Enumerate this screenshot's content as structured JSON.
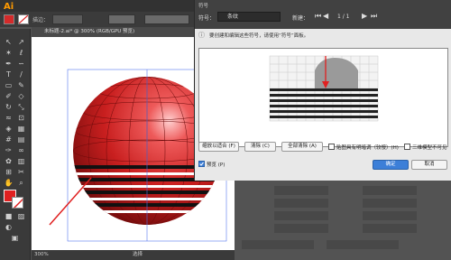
{
  "app": {
    "logo": "Ai"
  },
  "control_bar": {
    "stroke_label": "描边：",
    "fill_color": "#e02020"
  },
  "document": {
    "tab_title": "未标题-2.ai* @ 300% (RGB/GPU 预览)",
    "zoom": "300%",
    "status_label": "选择"
  },
  "dialog": {
    "title": "符号",
    "symbol_label": "符号：",
    "symbol_value": "条纹",
    "new_label": "新建：",
    "page_counter": "1 / 1",
    "message": "要创建和编辑这些符号，请使用“符号”面板。",
    "buttons": {
      "scale_to_fit": "缩放以适合 (F)",
      "clear": "清除 (C)",
      "clear_all": "全部清除 (A)",
      "ok": "确定",
      "cancel": "取消"
    },
    "checks": {
      "shade_artwork": "贴图具有明暗调（较慢）(H)",
      "invisible_geometry": "三维模型不可见",
      "preview": "预览 (P)"
    }
  },
  "colors": {
    "sphere": "#d42a2a",
    "arrow": "#e02020",
    "accent_button": "#3c7fd8"
  }
}
